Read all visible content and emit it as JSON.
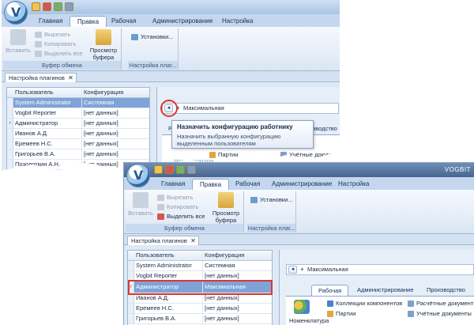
{
  "back": {
    "tabs": [
      "Главная",
      "Правка",
      "Рабочая",
      "Администрирование",
      "Настройка"
    ],
    "active_tab": "Правка",
    "ribbon": {
      "paste": "Вставить",
      "cut": "Вырезать",
      "copy": "Копировать",
      "select_all": "Выделить все",
      "clipboard_view": "Просмотр буфера обмена",
      "clipboard_group": "Буфер обмена",
      "settings": "Установки...",
      "plugins_group": "Настройка плаг..."
    },
    "doc_tab": "Настройка плагинов",
    "columns": [
      "Пользователь",
      "Конфигурация"
    ],
    "rows": [
      {
        "user": "System Administrator",
        "config": "Системная"
      },
      {
        "user": "Vogbit Reporter",
        "config": "[нет данных]"
      },
      {
        "user": "Администратор",
        "config": "[нет данных]"
      },
      {
        "user": "Иванов А.Д.",
        "config": "[нет данных]"
      },
      {
        "user": "Еремеев Н.С.",
        "config": "[нет данных]"
      },
      {
        "user": "Григорьев В.А.",
        "config": "[нет данных]"
      },
      {
        "user": "Позолоткин А.Н.",
        "config": "[нет данных]"
      },
      {
        "user": "Коновалов М.М.",
        "config": "[нет данных]"
      }
    ],
    "config_value": "Максимальная",
    "subtabs": [
      "Рабочая",
      "...производство"
    ],
    "sub_items": [
      "Партии",
      "Учётные докумен..."
    ],
    "partial_label": "Номенклатура"
  },
  "tooltip": {
    "title": "Назначить конфигурацию работнику",
    "body": "Назначить выбранную конфигурацию выделенным пользователям"
  },
  "front": {
    "window_title": "VOGBIT",
    "tabs": [
      "Главная",
      "Правка",
      "Рабочая",
      "Администрирование",
      "Настройка"
    ],
    "active_tab": "Правка",
    "ribbon": {
      "paste": "Вставить",
      "cut": "Вырезать",
      "copy": "Копировать",
      "select_all": "Выделить все",
      "clipboard_view": "Просмотр буфера обмена",
      "clipboard_group": "Буфер обмена",
      "settings": "Установки...",
      "plugins_group": "Настройка плаг..."
    },
    "doc_tab": "Настройка плагинов",
    "columns": [
      "Пользователь",
      "Конфигурация"
    ],
    "rows": [
      {
        "user": "System Administrator",
        "config": "Системная"
      },
      {
        "user": "Vogbit Reporter",
        "config": "[нет данных]"
      },
      {
        "user": "Администратор",
        "config": "Максимальная"
      },
      {
        "user": "Иванов А.Д.",
        "config": "[нет данных]"
      },
      {
        "user": "Еремеев Н.С.",
        "config": "[нет данных]"
      },
      {
        "user": "Григорьев В.А.",
        "config": "[нет данных]"
      }
    ],
    "config_value": "Максимальная",
    "subtabs": [
      "Рабочая",
      "Администрирование",
      "Производство"
    ],
    "sub_items": [
      "Коллекции компонентов",
      "Партии",
      "Расчётные документы",
      "Учётные документы"
    ],
    "nomenclature": "Номенклатура"
  },
  "colors": {
    "accent": "#2d6aa8",
    "selection": "#7fa3d6",
    "highlight": "#e03530"
  }
}
